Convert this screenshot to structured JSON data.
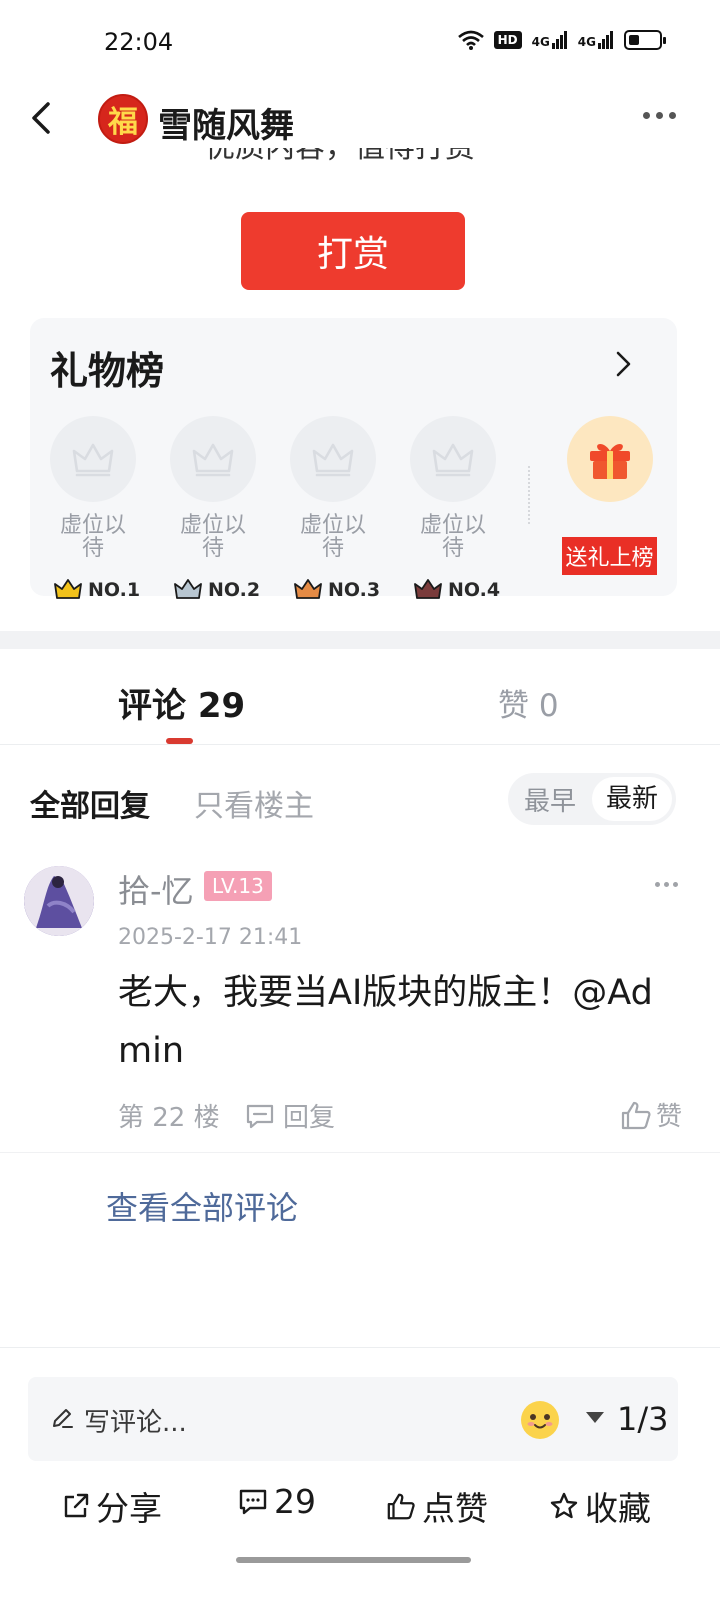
{
  "status_bar": {
    "time": "22:04",
    "hd_label": "HD",
    "signal1_label": "4G",
    "signal2_label": "4G"
  },
  "header": {
    "back_icon": "chevron-left-icon",
    "logo_char": "福",
    "title": "雪随风舞",
    "more_icon": "more-dots-icon"
  },
  "reward": {
    "cut_text": "优质内容，值得打赏",
    "button_label": "打赏"
  },
  "gift_board": {
    "title": "礼物榜",
    "slots": [
      {
        "label": "虚位以待",
        "rank": "NO.1",
        "crown_color": "#f2c21b"
      },
      {
        "label": "虚位以待",
        "rank": "NO.2",
        "crown_color": "#b8c6d1"
      },
      {
        "label": "虚位以待",
        "rank": "NO.3",
        "crown_color": "#e58b45"
      },
      {
        "label": "虚位以待",
        "rank": "NO.4",
        "crown_color": "#7a3b3b"
      }
    ],
    "send_gift_label": "送礼上榜"
  },
  "tabs": {
    "comments_label": "评论",
    "comments_count": "29",
    "likes_label": "赞",
    "likes_count": "0"
  },
  "filters": {
    "all": "全部回复",
    "owner_only": "只看楼主",
    "sort_earliest": "最早",
    "sort_latest": "最新"
  },
  "comment": {
    "username": "拾-忆",
    "level": "LV.13",
    "time": "2025-2-17 21:41",
    "text": "老大，我要当AI版块的版主！@Admin",
    "floor": "第 22 楼",
    "reply_label": "回复",
    "like_label": "赞"
  },
  "view_all_label": "查看全部评论",
  "bottom_bar": {
    "placeholder": "写评论...",
    "page_indicator": "1/3",
    "share_label": "分享",
    "comment_count": "29",
    "like_label": "点赞",
    "favorite_label": "收藏"
  },
  "colors": {
    "accent_red": "#ee3b2e",
    "link_blue": "#4f6a9a",
    "level_pink": "#f5a0b5"
  }
}
